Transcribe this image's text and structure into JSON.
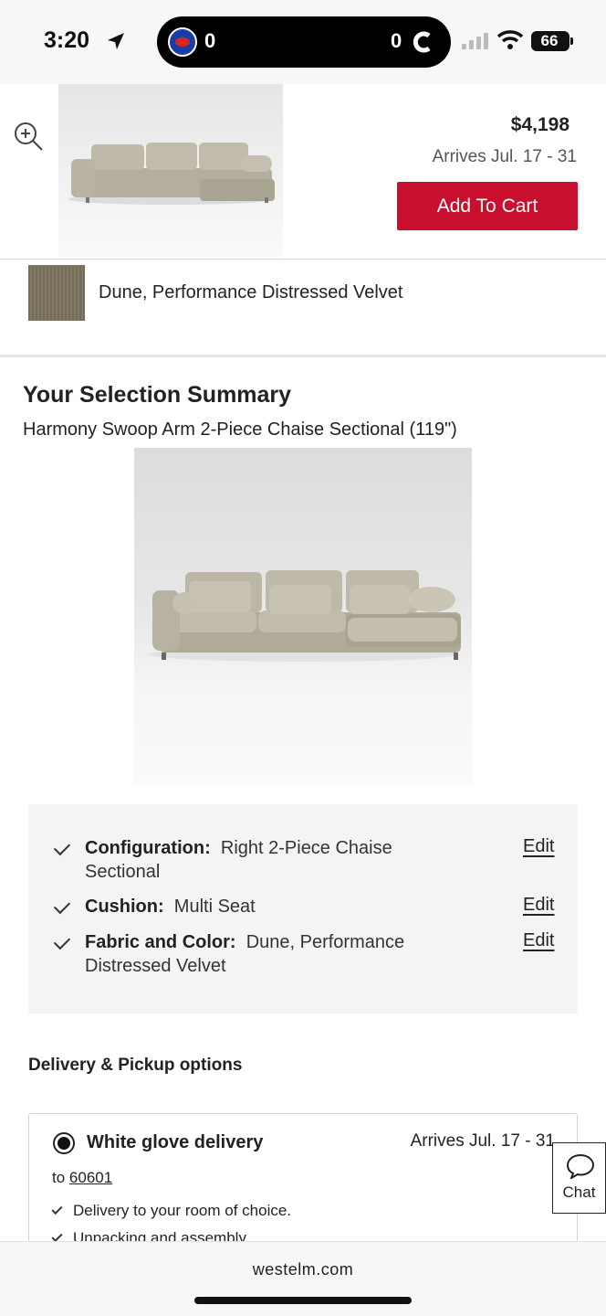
{
  "status_bar": {
    "time": "3:20",
    "score_left": "0",
    "score_right": "0",
    "battery": "66"
  },
  "sticky_header": {
    "price": "$4,198",
    "arrives": "Arrives Jul. 17 - 31",
    "add_to_cart_label": "Add To Cart"
  },
  "fabric": {
    "label": "Dune, Performance Distressed Velvet",
    "swatch_color": "#b0aa9a"
  },
  "summary": {
    "title": "Your Selection Summary",
    "product_name": "Harmony Swoop Arm 2-Piece Chaise Sectional (119\")",
    "options": [
      {
        "label": "Configuration:",
        "value": "Right 2-Piece Chaise Sectional",
        "edit": "Edit"
      },
      {
        "label": "Cushion:",
        "value": "Multi Seat",
        "edit": "Edit"
      },
      {
        "label": "Fabric and Color:",
        "value": "Dune, Performance Distressed Velvet",
        "edit": "Edit"
      }
    ]
  },
  "delivery": {
    "title": "Delivery & Pickup options",
    "option_title": "White glove delivery",
    "arrives": "Arrives Jul. 17 - 31",
    "to_prefix": "to",
    "zip": "60601",
    "perks": [
      "Delivery to your room of choice.",
      "Unpacking and assembly."
    ]
  },
  "chat": {
    "label": "Chat"
  },
  "browser": {
    "domain": "westelm.com"
  },
  "colors": {
    "accent": "#c8102e",
    "panel": "#f4f4f4"
  }
}
